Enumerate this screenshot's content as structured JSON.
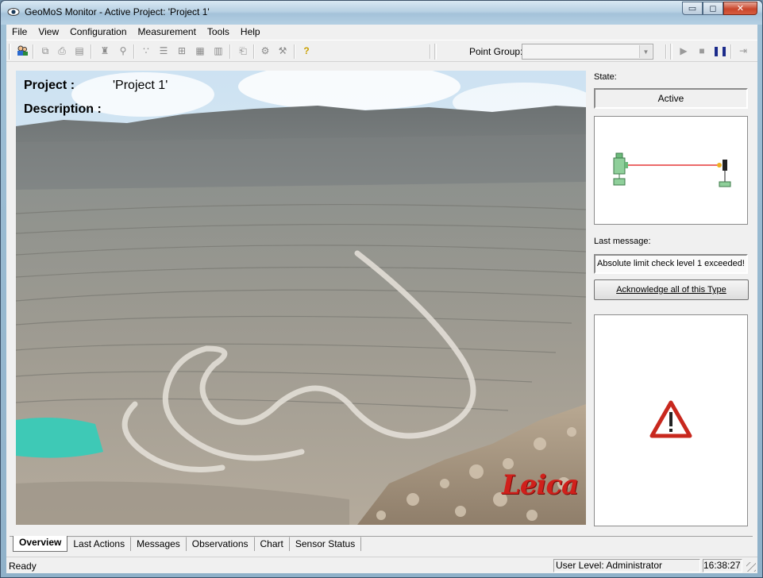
{
  "window": {
    "title": "GeoMoS Monitor - Active Project: 'Project 1'",
    "min_glyph": "▭",
    "max_glyph": "◻",
    "close_glyph": "✕"
  },
  "menu": [
    "File",
    "View",
    "Configuration",
    "Measurement",
    "Tools",
    "Help"
  ],
  "toolbar": {
    "point_group_label": "Point Group:",
    "point_group_value": "",
    "icons": [
      "users-icon",
      "copy-icon",
      "print-icon",
      "print-preview-icon",
      "sensor-icon",
      "tool-icon",
      "points-icon",
      "layers-icon",
      "grid-icon",
      "chart-icon",
      "book-icon",
      "export-icon",
      "settings-icon",
      "tools-icon",
      "help-icon",
      "play-icon",
      "stop-icon",
      "pause-icon",
      "step-icon"
    ]
  },
  "project": {
    "project_label": "Project :",
    "project_value": "'Project 1'",
    "description_label": "Description :",
    "logo_text": "Leica"
  },
  "right_panel": {
    "state_label": "State:",
    "state_value": "Active",
    "last_message_label": "Last message:",
    "last_message_value": "Absolute limit check level 1 exceeded! (",
    "acknowledge_button": "Acknowledge all of this Type"
  },
  "tabs": [
    "Overview",
    "Last Actions",
    "Messages",
    "Observations",
    "Chart",
    "Sensor Status"
  ],
  "active_tab": "Overview",
  "status": {
    "ready": "Ready",
    "user_level": "User Level: Administrator",
    "time": "16:38:27"
  },
  "colors": {
    "link_line": "#e01010",
    "warning_red": "#c8281e",
    "leica_red": "#d0201b",
    "water": "#3ec9b6"
  }
}
